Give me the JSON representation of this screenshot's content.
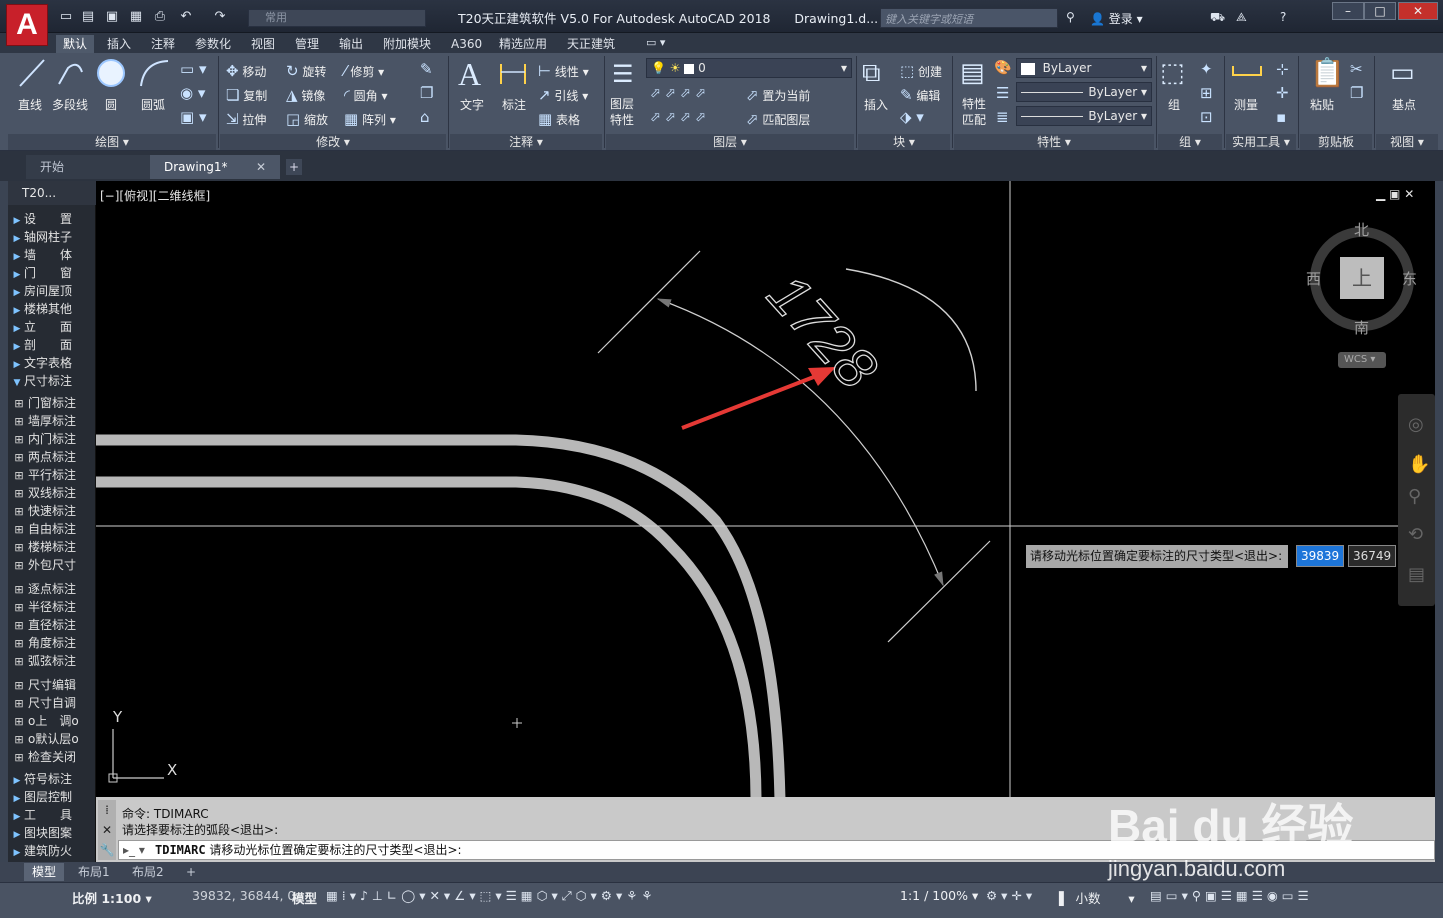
{
  "app": {
    "logo": "A",
    "title": "T20天正建筑软件 V5.0 For Autodesk AutoCAD 2018",
    "doc": "Drawing1.d...",
    "search_placeholder": "键入关键字或短语",
    "login": "登录",
    "workspace": "常用"
  },
  "menu_tabs": [
    "默认",
    "插入",
    "注释",
    "参数化",
    "视图",
    "管理",
    "输出",
    "附加模块",
    "A360",
    "精选应用",
    "天正建筑"
  ],
  "ribbon": {
    "draw": {
      "line": "直线",
      "polyline": "多段线",
      "circle": "圆",
      "arc": "圆弧",
      "label": "绘图"
    },
    "modify": {
      "move": "移动",
      "rotate": "旋转",
      "trim": "修剪",
      "copy": "复制",
      "mirror": "镜像",
      "fillet": "圆角",
      "stretch": "拉伸",
      "scale": "缩放",
      "array": "阵列",
      "label": "修改"
    },
    "annotation": {
      "text": "文字",
      "dim": "标注",
      "linear": "线性",
      "leader": "引线",
      "table": "表格",
      "label": "注释"
    },
    "layers": {
      "props": "图层特性",
      "layer_value": "0",
      "set_current": "置为当前",
      "match": "匹配图层",
      "label": "图层"
    },
    "block": {
      "insert": "插入",
      "create": "创建",
      "edit": "编辑",
      "label": "块"
    },
    "properties": {
      "match": "特性匹配",
      "color": "ByLayer",
      "linetype": "ByLayer",
      "lineweight": "ByLayer",
      "label": "特性"
    },
    "groups": {
      "group": "组",
      "label": "组"
    },
    "utilities": {
      "measure": "测量",
      "label": "实用工具"
    },
    "clipboard": {
      "paste": "粘贴",
      "label": "剪贴板"
    },
    "view": {
      "base": "基点",
      "label": "视图"
    }
  },
  "doc_tabs": [
    "开始",
    "Drawing1*"
  ],
  "viewport_label": "[−][俯视][二维线框]",
  "palette": {
    "title": "T20...",
    "items": [
      "设　　置",
      "轴网柱子",
      "墙　　体",
      "门　　窗",
      "房间屋顶",
      "楼梯其他",
      "立　　面",
      "剖　　面",
      "文字表格",
      "尺寸标注",
      "门窗标注",
      "墙厚标注",
      "内门标注",
      "两点标注",
      "平行标注",
      "双线标注",
      "快速标注",
      "自由标注",
      "楼梯标注",
      "外包尺寸",
      "逐点标注",
      "半径标注",
      "直径标注",
      "角度标注",
      "弧弦标注",
      "尺寸编辑",
      "尺寸自调",
      "o上　调o",
      "o默认层o",
      "检查关闭",
      "符号标注",
      "图层控制",
      "工　　具",
      "图块图案",
      "建筑防火"
    ]
  },
  "viewcube": {
    "north": "北",
    "south": "南",
    "east": "东",
    "west": "西",
    "top": "上",
    "wcs": "WCS"
  },
  "dimension_text": "1728",
  "dynamic_input": {
    "prompt": "请移动光标位置确定要标注的尺寸类型<退出>:",
    "x": "39839",
    "y": "36749"
  },
  "command": {
    "line1": "命令:  TDIMARC",
    "line2": "请选择要标注的弧段<退出>:",
    "current_cmd": "TDIMARC",
    "current_prompt": "请移动光标位置确定要标注的尺寸类型<退出>:"
  },
  "layout_tabs": [
    "模型",
    "布局1",
    "布局2"
  ],
  "status": {
    "scale": "比例 1:100",
    "coords": "39832, 36844, 0",
    "model": "模型",
    "anno_scale": "1:1 / 100%",
    "units": "小数"
  },
  "watermark": {
    "brand": "Bai du 经验",
    "url": "jingyan.baidu.com"
  }
}
